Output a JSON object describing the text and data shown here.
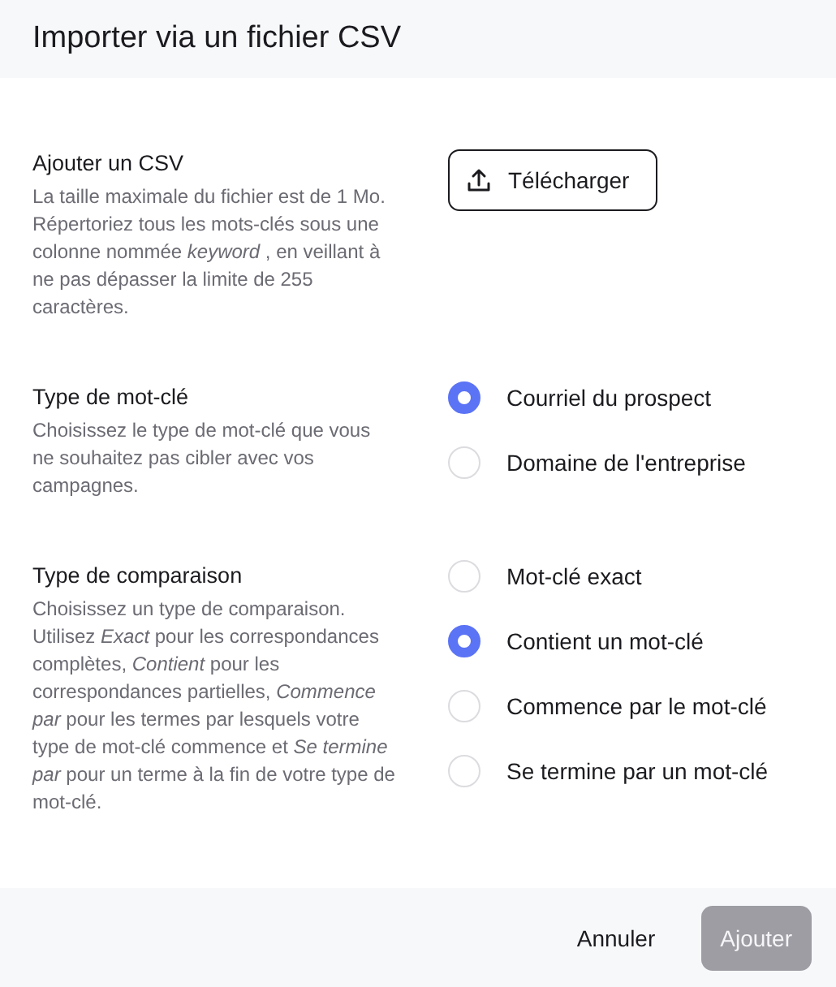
{
  "dialog": {
    "title": "Importer via un fichier CSV"
  },
  "sections": [
    {
      "kind": "upload",
      "title": "Ajouter un CSV",
      "description": "La taille maximale du fichier est de 1 Mo. Répertoriez tous les mots-clés sous une colonne nommée *keyword* , en veillant à ne pas dépasser la limite de 255 caractères.",
      "button": "Télécharger"
    },
    {
      "kind": "radio",
      "title": "Type de mot-clé",
      "description": "Choisissez le type de mot-clé que vous ne souhaitez pas cibler avec vos campagnes.",
      "options": [
        {
          "label": "Courriel du prospect",
          "selected": true
        },
        {
          "label": "Domaine de l'entreprise",
          "selected": false
        }
      ]
    },
    {
      "kind": "radio",
      "title": "Type de comparaison",
      "description": "Choisissez un type de comparaison. Utilisez *Exact* pour les correspondances complètes, *Contient* pour les correspondances partielles, *Commence par* pour les termes par lesquels votre type de mot-clé commence et *Se termine par* pour un terme à la fin de votre type de mot-clé.",
      "options": [
        {
          "label": "Mot-clé exact",
          "selected": false
        },
        {
          "label": "Contient un mot-clé",
          "selected": true
        },
        {
          "label": "Commence par le mot-clé",
          "selected": false
        },
        {
          "label": "Se termine par un mot-clé",
          "selected": false
        }
      ]
    }
  ],
  "footer": {
    "buttons": [
      {
        "label": "Annuler",
        "kind": "text",
        "disabled": false
      },
      {
        "label": "Ajouter",
        "kind": "primary",
        "disabled": true
      }
    ]
  }
}
